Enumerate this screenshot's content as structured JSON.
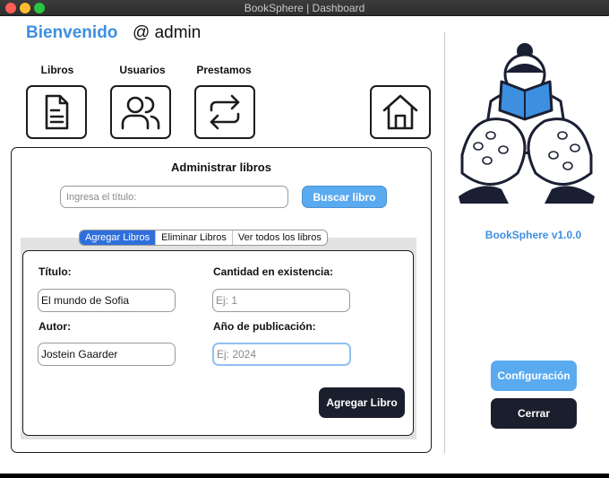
{
  "window": {
    "title": "BookSphere | Dashboard"
  },
  "header": {
    "welcome": "Bienvenido",
    "user": "@ admin"
  },
  "nav": [
    {
      "label": "Libros",
      "icon": "document-icon"
    },
    {
      "label": "Usuarios",
      "icon": "users-icon"
    },
    {
      "label": "Prestamos",
      "icon": "swap-arrows-icon"
    },
    {
      "label": "",
      "icon": "home-icon"
    }
  ],
  "panel": {
    "title": "Administrar libros",
    "search_placeholder": "Ingresa el título:",
    "search_button": "Buscar libro",
    "tabs": [
      "Agregar Libros",
      "Eliminar Libros",
      "Ver todos los libros"
    ],
    "active_tab": "Agregar Libros"
  },
  "form": {
    "title_label": "Título:",
    "title_value": "El mundo de Sofia",
    "author_label": "Autor:",
    "author_value": "Jostein Gaarder",
    "stock_label": "Cantidad en existencia:",
    "stock_placeholder": "Ej: 1",
    "year_label": "Año de publicación:",
    "year_placeholder": "Ej: 2024",
    "submit": "Agregar Libro"
  },
  "sidebar": {
    "version": "BookSphere v1.0.0",
    "config_button": "Configuración",
    "close_button": "Cerrar"
  },
  "colors": {
    "accent": "#3d8fe0",
    "button_blue": "#5aaaf0",
    "button_dark": "#1b1e2c",
    "tab_active": "#2f6fdc"
  }
}
